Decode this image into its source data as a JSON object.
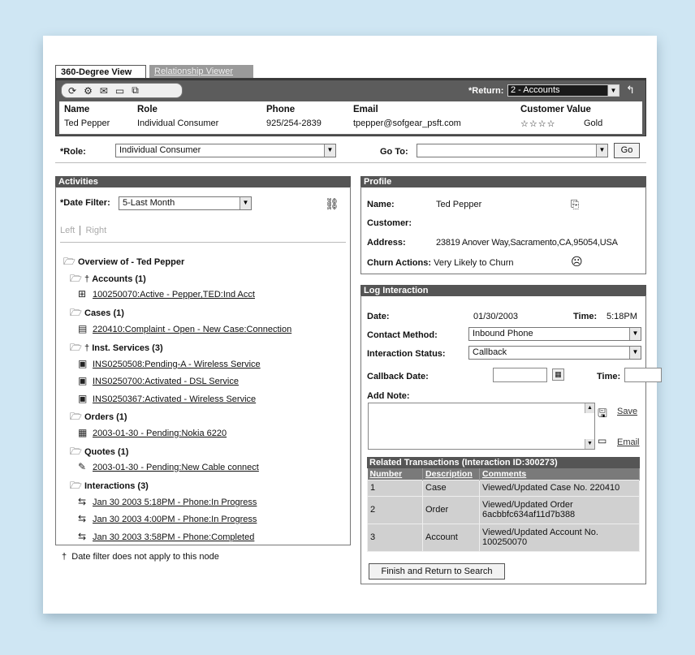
{
  "tabs": {
    "active": "360-Degree View",
    "inactive": "Relationship Viewer"
  },
  "toolbar": {
    "icons": [
      "refresh-icon",
      "settings-icon",
      "message-icon",
      "card-icon",
      "copy-icon"
    ],
    "return_label": "*Return:",
    "return_value": "2 - Accounts"
  },
  "header": {
    "name_label": "Name",
    "name": "Ted Pepper",
    "role_label": "Role",
    "role": "Individual Consumer",
    "phone_label": "Phone",
    "phone": "925/254-2839",
    "email_label": "Email",
    "email": "tpepper@sofgear_psft.com",
    "value_label": "Customer Value",
    "stars": "☆☆☆☆",
    "value": "Gold"
  },
  "role_row": {
    "role_label": "*Role:",
    "role_value": "Individual Consumer",
    "goto_label": "Go To:",
    "goto_value": "",
    "go_button": "Go"
  },
  "activities": {
    "title": "Activities",
    "date_filter_label": "*Date Filter:",
    "date_filter_value": "5-Last Month",
    "left": "Left",
    "right": "Right",
    "root": "Overview of - Ted Pepper",
    "groups": [
      {
        "label": "Accounts (1)",
        "dagger": "†",
        "items": [
          "100250070:Active - Pepper,TED:Ind Acct"
        ]
      },
      {
        "label": "Cases (1)",
        "dagger": "",
        "items": [
          "220410:Complaint - Open - New Case:Connection"
        ]
      },
      {
        "label": "Inst. Services (3)",
        "dagger": "†",
        "items": [
          "INS0250508:Pending-A - Wireless Service",
          "INS0250700:Activated - DSL Service",
          "INS0250367:Activated - Wireless Service"
        ]
      },
      {
        "label": "Orders (1)",
        "dagger": "",
        "items": [
          "2003-01-30 - Pending:Nokia 6220"
        ]
      },
      {
        "label": "Quotes (1)",
        "dagger": "",
        "items": [
          "2003-01-30 - Pending:New Cable connect"
        ]
      },
      {
        "label": "Interactions (3)",
        "dagger": "",
        "items": [
          "Jan 30 2003 5:18PM - Phone:In Progress",
          "Jan 30 2003 4:00PM - Phone:In Progress",
          "Jan 30 2003 3:58PM - Phone:Completed"
        ]
      }
    ],
    "footnote_mark": "†",
    "footnote": "Date filter does not apply to this node"
  },
  "profile": {
    "title": "Profile",
    "name_label": "Name:",
    "name": "Ted Pepper",
    "customer_label": "Customer:",
    "address_label": "Address:",
    "address": "23819 Anover Way,Sacramento,CA,95054,USA",
    "churn_label": "Churn Actions:",
    "churn": "Very Likely to Churn"
  },
  "log": {
    "title": "Log Interaction",
    "date_label": "Date:",
    "date": "01/30/2003",
    "time_label": "Time:",
    "time": "5:18PM",
    "contact_label": "Contact Method:",
    "contact": "Inbound Phone",
    "status_label": "Interaction Status:",
    "status": "Callback",
    "callback_label": "Callback Date:",
    "callback_time_label": "Time:",
    "note_label": "Add Note:",
    "save": "Save",
    "email": "Email"
  },
  "related": {
    "title": "Related Transactions (Interaction ID:300273)",
    "columns": [
      "Number",
      "Description",
      "Comments"
    ],
    "rows": [
      {
        "num": "1",
        "desc": "Case",
        "comment": "Viewed/Updated Case No. 220410"
      },
      {
        "num": "2",
        "desc": "Order",
        "comment": "Viewed/Updated Order 6acbbfc634af11d7b388"
      },
      {
        "num": "3",
        "desc": "Account",
        "comment": "Viewed/Updated Account No. 100250070"
      }
    ]
  },
  "finish_button": "Finish and Return to Search"
}
